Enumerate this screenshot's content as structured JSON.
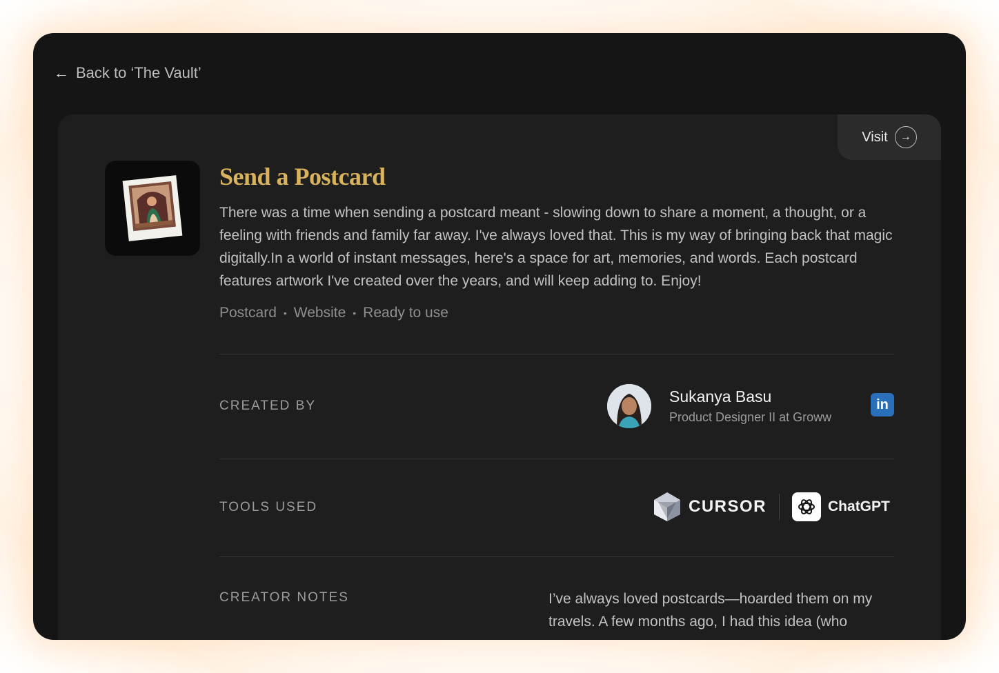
{
  "nav": {
    "back_arrow": "←",
    "back_label": "Back to ‘The Vault’"
  },
  "visit": {
    "label": "Visit",
    "arrow": "→"
  },
  "project": {
    "title": "Send a Postcard",
    "description": "There was a time when sending a postcard meant - slowing down to share a moment, a thought, or a feeling with friends and family far away. I've always loved that. This is my way of bringing back that magic digitally.In a world of instant messages, here's a space for art, memories, and words. Each postcard features artwork I've created over the years, and will keep adding to. Enjoy!",
    "tags": [
      "Postcard",
      "Website",
      "Ready to use"
    ],
    "tag_separator": "•"
  },
  "created_by": {
    "label": "CREATED BY",
    "name": "Sukanya Basu",
    "role": "Product Designer II at Groww",
    "social_icon": "linkedin-icon",
    "social_glyph": "in"
  },
  "tools_used": {
    "label": "TOOLS USED",
    "tools": [
      {
        "name": "CURSOR",
        "icon": "cursor-logo-icon"
      },
      {
        "name": "ChatGPT",
        "icon": "chatgpt-logo-icon"
      }
    ]
  },
  "creator_notes": {
    "label": "CREATOR NOTES",
    "text": "I’ve always loved postcards—hoarded them on my travels. A few months ago, I had this idea (who"
  },
  "colors": {
    "window_bg": "#151516",
    "card_bg": "#1e1e1f",
    "title_gold": "#d9b25c",
    "linkedin_blue": "#2a6fba"
  }
}
